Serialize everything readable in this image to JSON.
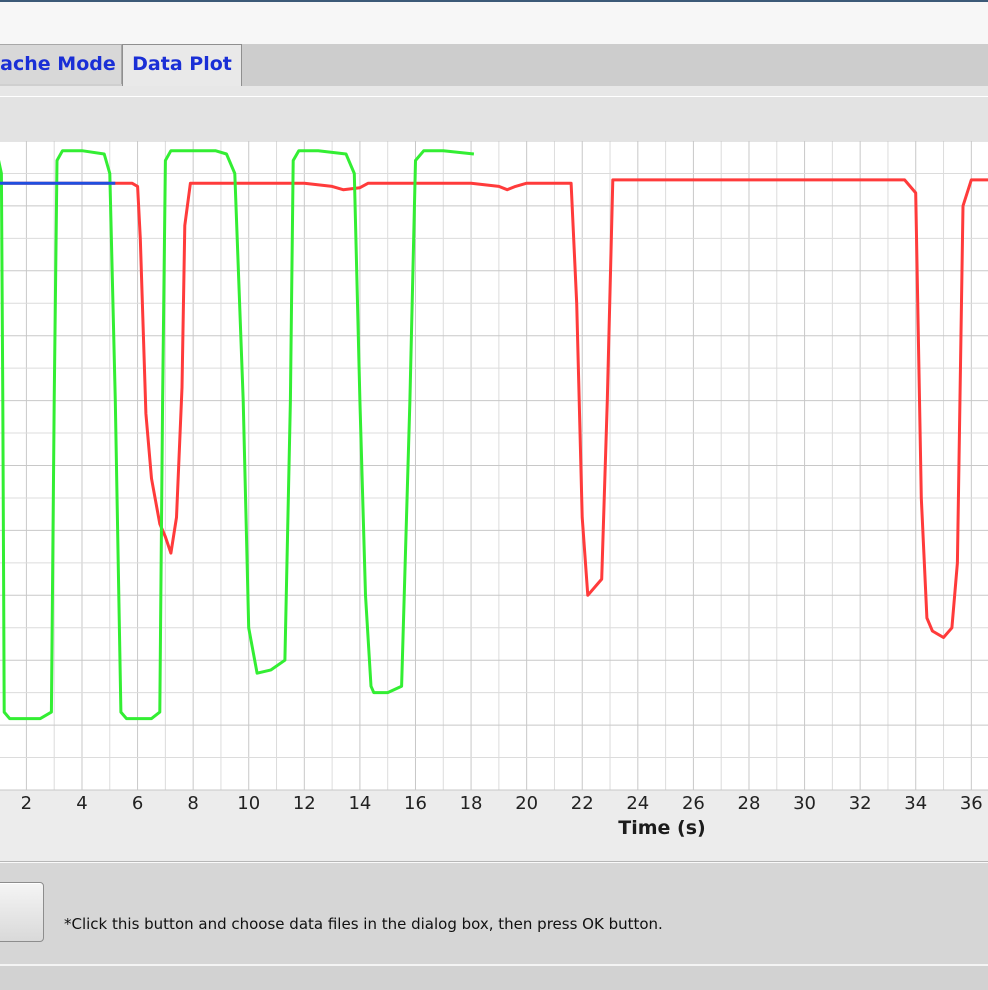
{
  "tabs": [
    {
      "label": "Cache Mode",
      "active": false
    },
    {
      "label": "Data Plot",
      "active": true
    }
  ],
  "hint_text": "*Click this button and choose data files in the dialog box, then press OK button.",
  "chart_data": {
    "type": "line",
    "xlabel": "Time (s)",
    "ylabel": "",
    "x_ticks": [
      2,
      4,
      6,
      8,
      10,
      12,
      14,
      16,
      18,
      20,
      22,
      24,
      26,
      28,
      30,
      32,
      34,
      36
    ],
    "xlim": [
      1.05,
      36.6
    ],
    "ylim": [
      0,
      1
    ],
    "grid": true,
    "series": [
      {
        "color": "#ff3b3b",
        "x": [
          1.0,
          5.0,
          5.8,
          6.0,
          6.1,
          6.3,
          6.5,
          6.8,
          7.0,
          7.2,
          7.4,
          7.6,
          7.7,
          7.9,
          9,
          11,
          12,
          13,
          13.4,
          14,
          14.3,
          15,
          16,
          17,
          18,
          19,
          19.3,
          19.6,
          20,
          21,
          21.6,
          21.8,
          22.0,
          22.2,
          22.5,
          22.7,
          22.9,
          23.1,
          24,
          26,
          28,
          30,
          32,
          33.6,
          34.0,
          34.2,
          34.4,
          34.6,
          35.0,
          35.3,
          35.5,
          35.7,
          36.0,
          36.6
        ],
        "y": [
          0.935,
          0.935,
          0.935,
          0.93,
          0.85,
          0.58,
          0.48,
          0.41,
          0.39,
          0.365,
          0.42,
          0.62,
          0.87,
          0.935,
          0.935,
          0.935,
          0.935,
          0.93,
          0.925,
          0.928,
          0.935,
          0.935,
          0.935,
          0.935,
          0.935,
          0.93,
          0.925,
          0.93,
          0.935,
          0.935,
          0.935,
          0.75,
          0.42,
          0.3,
          0.315,
          0.325,
          0.6,
          0.94,
          0.94,
          0.94,
          0.94,
          0.94,
          0.94,
          0.94,
          0.92,
          0.45,
          0.265,
          0.245,
          0.235,
          0.25,
          0.35,
          0.9,
          0.94,
          0.94
        ]
      },
      {
        "color": "#33ee33",
        "x": [
          1.0,
          1.1,
          1.15,
          1.2,
          1.4,
          1.6,
          2.0,
          2.5,
          2.9,
          3.0,
          3.1,
          3.3,
          4.0,
          4.8,
          5.0,
          5.2,
          5.4,
          5.6,
          6.0,
          6.5,
          6.8,
          6.9,
          7.0,
          7.2,
          8.0,
          8.8,
          9.2,
          9.5,
          9.8,
          10.0,
          10.3,
          10.8,
          11.3,
          11.5,
          11.6,
          11.8,
          12.5,
          13.5,
          13.8,
          14.0,
          14.2,
          14.4,
          14.5,
          15.0,
          15.5,
          15.8,
          16.0,
          16.3,
          17,
          18.1
        ],
        "y": [
          0.97,
          0.95,
          0.6,
          0.12,
          0.11,
          0.11,
          0.11,
          0.11,
          0.12,
          0.6,
          0.97,
          0.985,
          0.985,
          0.98,
          0.95,
          0.6,
          0.12,
          0.11,
          0.11,
          0.11,
          0.12,
          0.6,
          0.97,
          0.985,
          0.985,
          0.985,
          0.98,
          0.95,
          0.6,
          0.25,
          0.18,
          0.185,
          0.2,
          0.6,
          0.97,
          0.985,
          0.985,
          0.98,
          0.95,
          0.6,
          0.3,
          0.16,
          0.15,
          0.15,
          0.16,
          0.6,
          0.97,
          0.985,
          0.985,
          0.98
        ]
      },
      {
        "color": "#1f4fe0",
        "x": [
          1.0,
          2,
          3,
          4,
          5.2
        ],
        "y": [
          0.935,
          0.935,
          0.935,
          0.935,
          0.935
        ]
      }
    ]
  }
}
